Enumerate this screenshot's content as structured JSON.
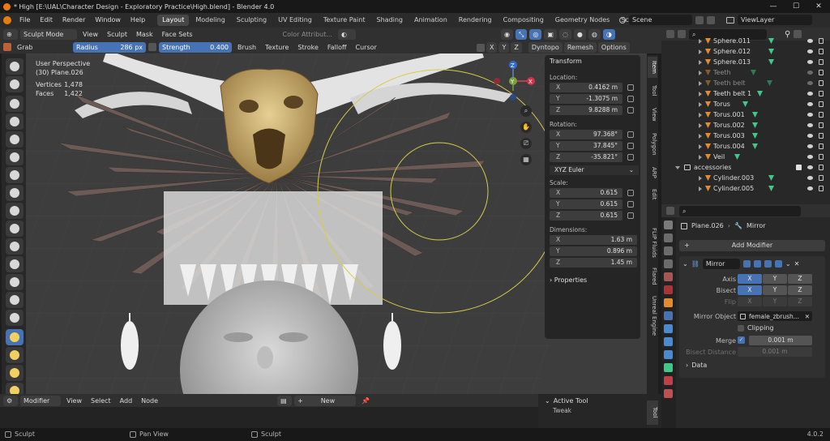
{
  "window": {
    "title": "* High [E:\\UAL\\Character Design - Exploratory Practice\\High.blend] - Blender 4.0",
    "controls": {
      "minimize": "—",
      "maximize": "☐",
      "close": "✕"
    }
  },
  "menu": [
    "File",
    "Edit",
    "Render",
    "Window",
    "Help"
  ],
  "workspaces": [
    "Layout",
    "Modeling",
    "Sculpting",
    "UV Editing",
    "Texture Paint",
    "Shading",
    "Animation",
    "Rendering",
    "Compositing",
    "Geometry Nodes",
    "Scripting"
  ],
  "workspace_add": "+",
  "scene": {
    "label": "Scene",
    "viewlayer": "ViewLayer"
  },
  "header": {
    "mode": "Sculpt Mode",
    "menus": [
      "View",
      "Sculpt",
      "Mask",
      "Face Sets"
    ],
    "color_attr": "Color Attribut...",
    "axes": [
      "X",
      "Y",
      "Z"
    ],
    "dyntopo": "Dyntopo",
    "remesh": "Remesh",
    "options": "Options"
  },
  "tool_settings": {
    "brush": "Grab",
    "radius_label": "Radius",
    "radius_value": "286 px",
    "strength_label": "Strength",
    "strength_value": "0.400",
    "menus": [
      "Brush",
      "Texture",
      "Stroke",
      "Falloff",
      "Cursor"
    ]
  },
  "viewport": {
    "perspective": "User Perspective",
    "object": "(30) Plane.026",
    "vertices_label": "Vertices",
    "vertices_value": "1,478",
    "faces_label": "Faces",
    "faces_value": "1,422",
    "gizmo_axes": [
      "Z",
      "Y",
      "X"
    ]
  },
  "transform": {
    "title": "Transform",
    "location_label": "Location:",
    "location": [
      {
        "axis": "X",
        "value": "0.4162 m"
      },
      {
        "axis": "Y",
        "value": "-1.3075 m"
      },
      {
        "axis": "Z",
        "value": "9.8288 m"
      }
    ],
    "rotation_label": "Rotation:",
    "rotation": [
      {
        "axis": "X",
        "value": "97.368°"
      },
      {
        "axis": "Y",
        "value": "37.845°"
      },
      {
        "axis": "Z",
        "value": "-35.821°"
      }
    ],
    "rotation_mode": "XYZ Euler",
    "scale_label": "Scale:",
    "scale": [
      {
        "axis": "X",
        "value": "0.615"
      },
      {
        "axis": "Y",
        "value": "0.615"
      },
      {
        "axis": "Z",
        "value": "0.615"
      }
    ],
    "dimensions_label": "Dimensions:",
    "dimensions": [
      {
        "axis": "X",
        "value": "1.63 m"
      },
      {
        "axis": "Y",
        "value": "0.896 m"
      },
      {
        "axis": "Z",
        "value": "1.45 m"
      }
    ],
    "properties": "Properties"
  },
  "npanel_tabs": [
    "Item",
    "Tool",
    "View",
    "Polygon",
    "ARP",
    "Edit",
    "FLIP Fluids",
    "Flared",
    "Unreal Engine"
  ],
  "outliner": {
    "rows": [
      {
        "name": "Sphere.011",
        "dim": false
      },
      {
        "name": "Sphere.012",
        "dim": false
      },
      {
        "name": "Sphere.013",
        "dim": false
      },
      {
        "name": "Teeth",
        "dim": true
      },
      {
        "name": "Teeth belt",
        "dim": true
      },
      {
        "name": "Teeth belt 1",
        "dim": false
      },
      {
        "name": "Torus",
        "dim": false
      },
      {
        "name": "Torus.001",
        "dim": false
      },
      {
        "name": "Torus.002",
        "dim": false
      },
      {
        "name": "Torus.003",
        "dim": false
      },
      {
        "name": "Torus.004",
        "dim": false
      },
      {
        "name": "Veil",
        "dim": false
      },
      {
        "name": "accessories",
        "dim": false
      },
      {
        "name": "Cylinder.003",
        "dim": false
      },
      {
        "name": "Cylinder.005",
        "dim": false
      }
    ]
  },
  "properties": {
    "object": "Plane.026",
    "modifier_breadcrumb": "Mirror",
    "add_modifier": "Add Modifier",
    "modifier_name": "Mirror",
    "axis_label": "Axis",
    "bisect_label": "Bisect",
    "flip_label": "Flip",
    "axes": [
      "X",
      "Y",
      "Z"
    ],
    "mirror_object_label": "Mirror Object",
    "mirror_object": "female_zbrush...",
    "clipping": "Clipping",
    "merge_label": "Merge",
    "merge_value": "0.001 m",
    "bisect_distance_label": "Bisect Distance",
    "bisect_distance_value": "0.001 m",
    "data": "Data"
  },
  "timeline_header": {
    "mode": "Modifier",
    "menus": [
      "View",
      "Select",
      "Add",
      "Node"
    ],
    "new": "New"
  },
  "active_tool": {
    "title": "Active Tool",
    "tool": "Tweak",
    "tab": "Tool"
  },
  "status": {
    "left": "Sculpt",
    "middle": "Pan View",
    "right": "Sculpt",
    "version": "4.0.2"
  },
  "colors": {
    "accent": "#4772b3",
    "object_orange": "#e38b2d",
    "mesh_green": "#3fc889",
    "blender_orange": "#e87d0d"
  }
}
